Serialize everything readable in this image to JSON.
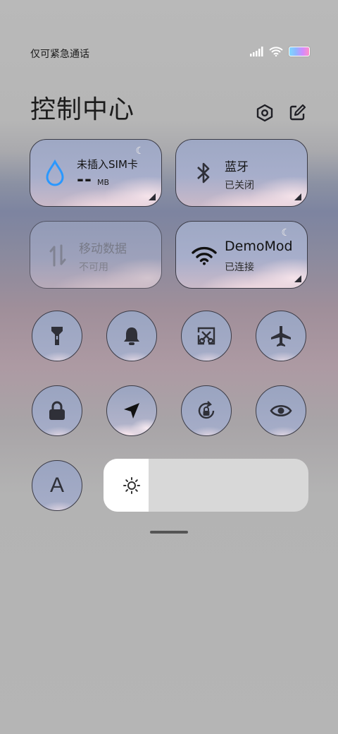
{
  "status": {
    "carrier_text": "仅可紧急通话",
    "icons": [
      "signal-icon",
      "wifi-icon",
      "battery-icon"
    ]
  },
  "header": {
    "title": "控制中心",
    "settings_icon": "hexagon-settings-icon",
    "edit_icon": "edit-icon"
  },
  "tiles": [
    {
      "name": "mobile-data-sim",
      "title": "未插入SIM卡",
      "value": "--",
      "unit": "MB"
    },
    {
      "name": "bluetooth",
      "title": "蓝牙",
      "subtitle": "已关闭"
    },
    {
      "name": "mobile-data",
      "title": "移动数据",
      "subtitle": "不可用"
    },
    {
      "name": "wifi",
      "title": "DemoMod",
      "subtitle": "已连接"
    }
  ],
  "toggles_row1": [
    "flashlight-icon",
    "bell-icon",
    "screenshot-icon",
    "airplane-icon"
  ],
  "toggles_row2": [
    "lock-icon",
    "location-icon",
    "rotation-lock-icon",
    "eye-icon"
  ],
  "font_button": {
    "label": "A"
  },
  "brightness": {
    "level": 0.22
  },
  "colors": {
    "accent": "#2a98ff",
    "tile_border": "#3b3b46",
    "icon": "#2f3038"
  }
}
